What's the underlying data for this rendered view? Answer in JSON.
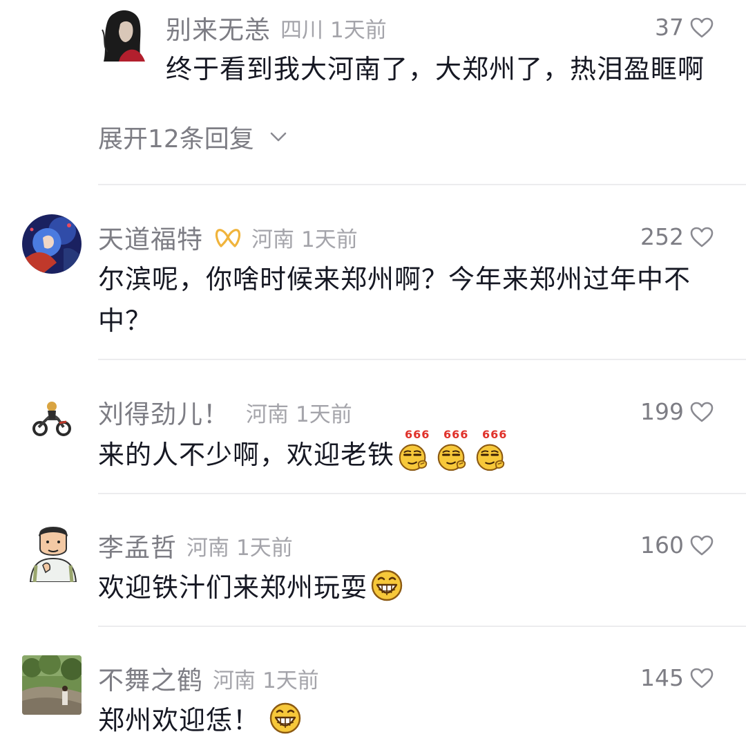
{
  "comments": [
    {
      "username": "别来无恙",
      "region": "四川",
      "time": "1天前",
      "text": "终于看到我大河南了，大郑州了，热泪盈眶啊",
      "likes": "37",
      "avatar": "girl-portrait-avatar"
    },
    {
      "username": "天道福特",
      "region": "河南",
      "time": "1天前",
      "text_line1": "尔滨呢，你啥时候来郑州啊？今年来郑州过年中不",
      "text_line2": "中？",
      "likes": "252",
      "avatar": "anime-avatar",
      "badge": "gold-ribbon-badge-icon"
    },
    {
      "username": "刘得劲儿！",
      "region": "河南",
      "time": "1天前",
      "text": "来的人不少啊，欢迎老铁",
      "emoji_labels": [
        "666",
        "666",
        "666"
      ],
      "likes": "199",
      "avatar": "motorcycle-avatar"
    },
    {
      "username": "李孟哲",
      "region": "河南",
      "time": "1天前",
      "text": "欢迎铁汁们来郑州玩耍",
      "likes": "160",
      "avatar": "cartoon-man-avatar"
    },
    {
      "username": "不舞之鹤",
      "region": "河南",
      "time": "1天前",
      "text": "郑州欢迎恁！",
      "likes": "145",
      "avatar": "landscape-photo-avatar"
    }
  ],
  "expand_replies": {
    "label": "展开12条回复"
  },
  "colors": {
    "username": "#7d7d84",
    "meta": "#a4a4aa",
    "text": "#161823",
    "divider": "#ececee",
    "badge": "#f0b43c"
  },
  "icons": {
    "like": "heart-outline-icon",
    "expand": "chevron-down-icon",
    "emoji_666": "emoji-666-icon",
    "emoji_grin": "emoji-grin-icon"
  }
}
